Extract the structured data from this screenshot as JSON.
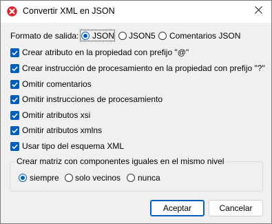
{
  "window": {
    "title": "Convertir XML en JSON",
    "icon": "altova-x-icon",
    "close_icon": "close-icon"
  },
  "output_format": {
    "label": "Formato de salida:",
    "options": [
      "JSON",
      "JSON5",
      "Comentarios JSON"
    ],
    "selected": "JSON"
  },
  "checkboxes": [
    {
      "label": "Crear atributo en la propiedad con prefijo \"@\"",
      "checked": true
    },
    {
      "label": "Crear instrucción de procesamiento en la propiedad con prefijo \"?\"",
      "checked": true
    },
    {
      "label": "Omitir comentarios",
      "checked": true
    },
    {
      "label": "Omitir instrucciones de procesamiento",
      "checked": true
    },
    {
      "label": "Omitir atributos xsi",
      "checked": true
    },
    {
      "label": "Omitir atributos xmlns",
      "checked": true
    },
    {
      "label": "Usar tipo del esquema XML",
      "checked": true
    }
  ],
  "array_group": {
    "legend": "Crear matriz con componentes iguales en el mismo nivel",
    "options": [
      "siempre",
      "solo vecinos",
      "nunca"
    ],
    "selected": "siempre"
  },
  "buttons": {
    "ok": "Aceptar",
    "cancel": "Cancelar"
  },
  "colors": {
    "accent": "#005fb8",
    "icon_red": "#d9242b"
  }
}
